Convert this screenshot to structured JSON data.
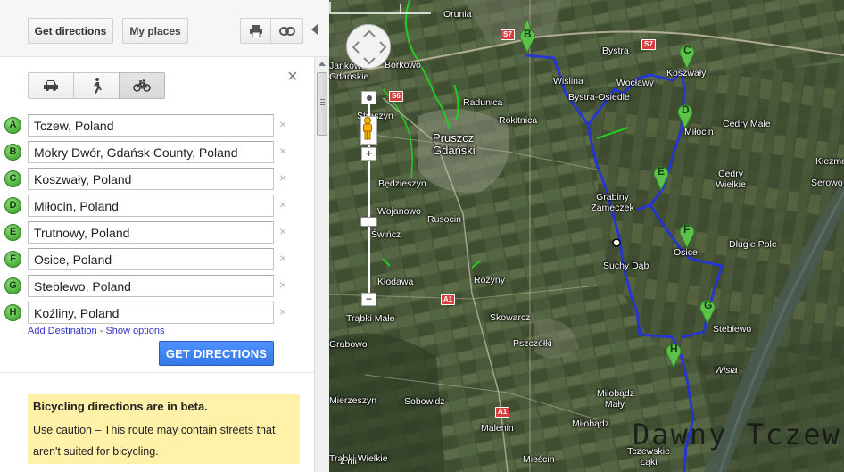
{
  "toolbar": {
    "get_directions_label": "Get directions",
    "my_places_label": "My places"
  },
  "modes": [
    "car-icon",
    "walking-icon",
    "bicycle-icon"
  ],
  "selected_mode": "bicycle",
  "close_label": "×",
  "destinations": [
    {
      "letter": "A",
      "value": "Tczew, Poland"
    },
    {
      "letter": "B",
      "value": "Mokry Dwór, Gdańsk County, Poland"
    },
    {
      "letter": "C",
      "value": "Koszwały, Poland"
    },
    {
      "letter": "D",
      "value": "Miłocin, Poland"
    },
    {
      "letter": "E",
      "value": "Trutnowy, Poland"
    },
    {
      "letter": "F",
      "value": "Osice, Poland"
    },
    {
      "letter": "G",
      "value": "Steblewo, Poland"
    },
    {
      "letter": "H",
      "value": "Koźliny, Poland"
    }
  ],
  "remove_glyph": "×",
  "links": {
    "add_destination": "Add Destination",
    "separator": "-",
    "show_options": "Show options"
  },
  "get_directions_button": "GET DIRECTIONS",
  "beta_notice": {
    "title": "Bicycling directions are in beta.",
    "text": "Use caution – This route may contain streets that aren't suited for bicycling."
  },
  "map": {
    "place_labels": [
      "Orunia",
      "Jankowo Gdańskie",
      "Borkowo",
      "Bystra",
      "Koszwały",
      "Wiślina",
      "Bystra-Osiedle",
      "Wocławy",
      "Radunica",
      "Straszyn",
      "Rokitnica",
      "Cedry Małe",
      "Pruszcz Gdański",
      "Kiezmark",
      "Będzieszyn",
      "Cedry Wielkie",
      "Serowo",
      "Grabiny Zameczek",
      "Wojanowo",
      "Rusocin",
      "Świńcz",
      "Długie Pole",
      "Osice",
      "Suchy Dąb",
      "Kłodawa",
      "Różyny",
      "Trąbki Małe",
      "Skowarcz",
      "Pszczółki",
      "Wisła",
      "Milobądz Mały",
      "Sobowidz",
      "Mierzeszyn",
      "Malenin",
      "Miłobądz",
      "Grabowo",
      "Tczewskie Łąki",
      "Mieścin",
      "Trąbki Wielkie",
      "Miłocin",
      "Steblewo"
    ],
    "road_labels": [
      "S7",
      "S7",
      "S6",
      "A1",
      "A1"
    ],
    "pins": [
      "B",
      "C",
      "D",
      "E",
      "F",
      "G",
      "H"
    ],
    "route_color": "#2233dd",
    "pin_color": "#5cc24a",
    "scale_label": "2 mi",
    "watermark": "Dawny Tczew"
  }
}
